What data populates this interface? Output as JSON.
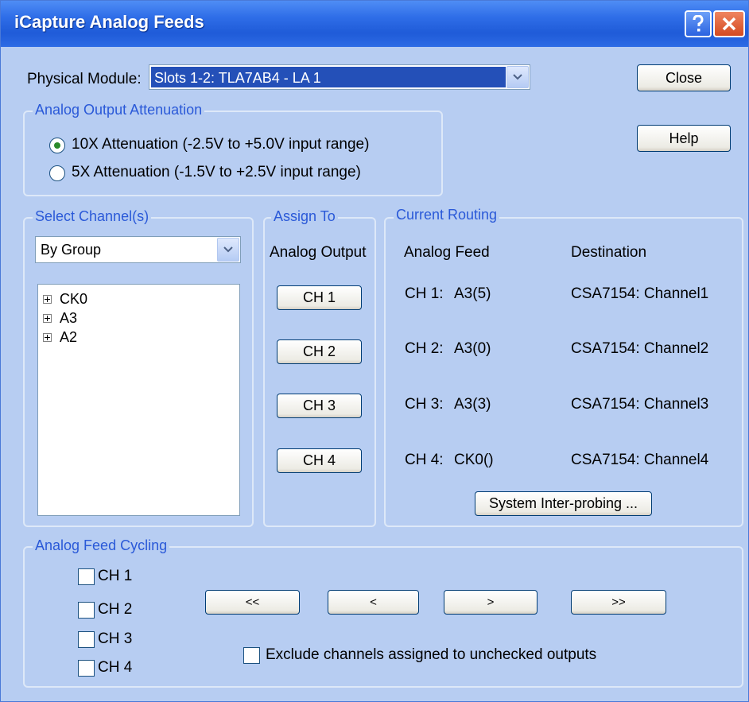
{
  "window": {
    "title": "iCapture Analog Feeds"
  },
  "physical_module": {
    "label": "Physical Module:",
    "value": "Slots 1-2: TLA7AB4 - LA 1"
  },
  "buttons": {
    "close": "Close",
    "help": "Help",
    "system_interprobing": "System Inter-probing ..."
  },
  "attenuation": {
    "title": "Analog Output Attenuation",
    "options": [
      {
        "label": "10X Attenuation (-2.5V to +5.0V input range)",
        "selected": true
      },
      {
        "label": "5X Attenuation (-1.5V to +2.5V input range)",
        "selected": false
      }
    ]
  },
  "select_channels": {
    "title": "Select Channel(s)",
    "group_by": "By Group",
    "tree": [
      "CK0",
      "A3",
      "A2"
    ]
  },
  "assign_to": {
    "title": "Assign To",
    "header": "Analog Output",
    "buttons": [
      "CH 1",
      "CH 2",
      "CH 3",
      "CH 4"
    ]
  },
  "current_routing": {
    "title": "Current Routing",
    "headers": {
      "feed": "Analog Feed",
      "destination": "Destination"
    },
    "rows": [
      {
        "ch": "CH 1:",
        "feed": "A3(5)",
        "destination": "CSA7154: Channel1"
      },
      {
        "ch": "CH 2:",
        "feed": "A3(0)",
        "destination": "CSA7154: Channel2"
      },
      {
        "ch": "CH 3:",
        "feed": "A3(3)",
        "destination": "CSA7154: Channel3"
      },
      {
        "ch": "CH 4:",
        "feed": "CK0()",
        "destination": "CSA7154: Channel4"
      }
    ]
  },
  "cycling": {
    "title": "Analog Feed Cycling",
    "channels": [
      "CH 1",
      "CH 2",
      "CH 3",
      "CH 4"
    ],
    "nav": {
      "first": "<<",
      "prev": "<",
      "next": ">",
      "last": ">>"
    },
    "exclude_label": "Exclude channels assigned to unchecked outputs"
  },
  "colors": {
    "dialog_bg": "#b7cdf2",
    "group_title": "#2a59d8",
    "title_bar": "#2f6ee8",
    "selection": "#2450b8"
  }
}
